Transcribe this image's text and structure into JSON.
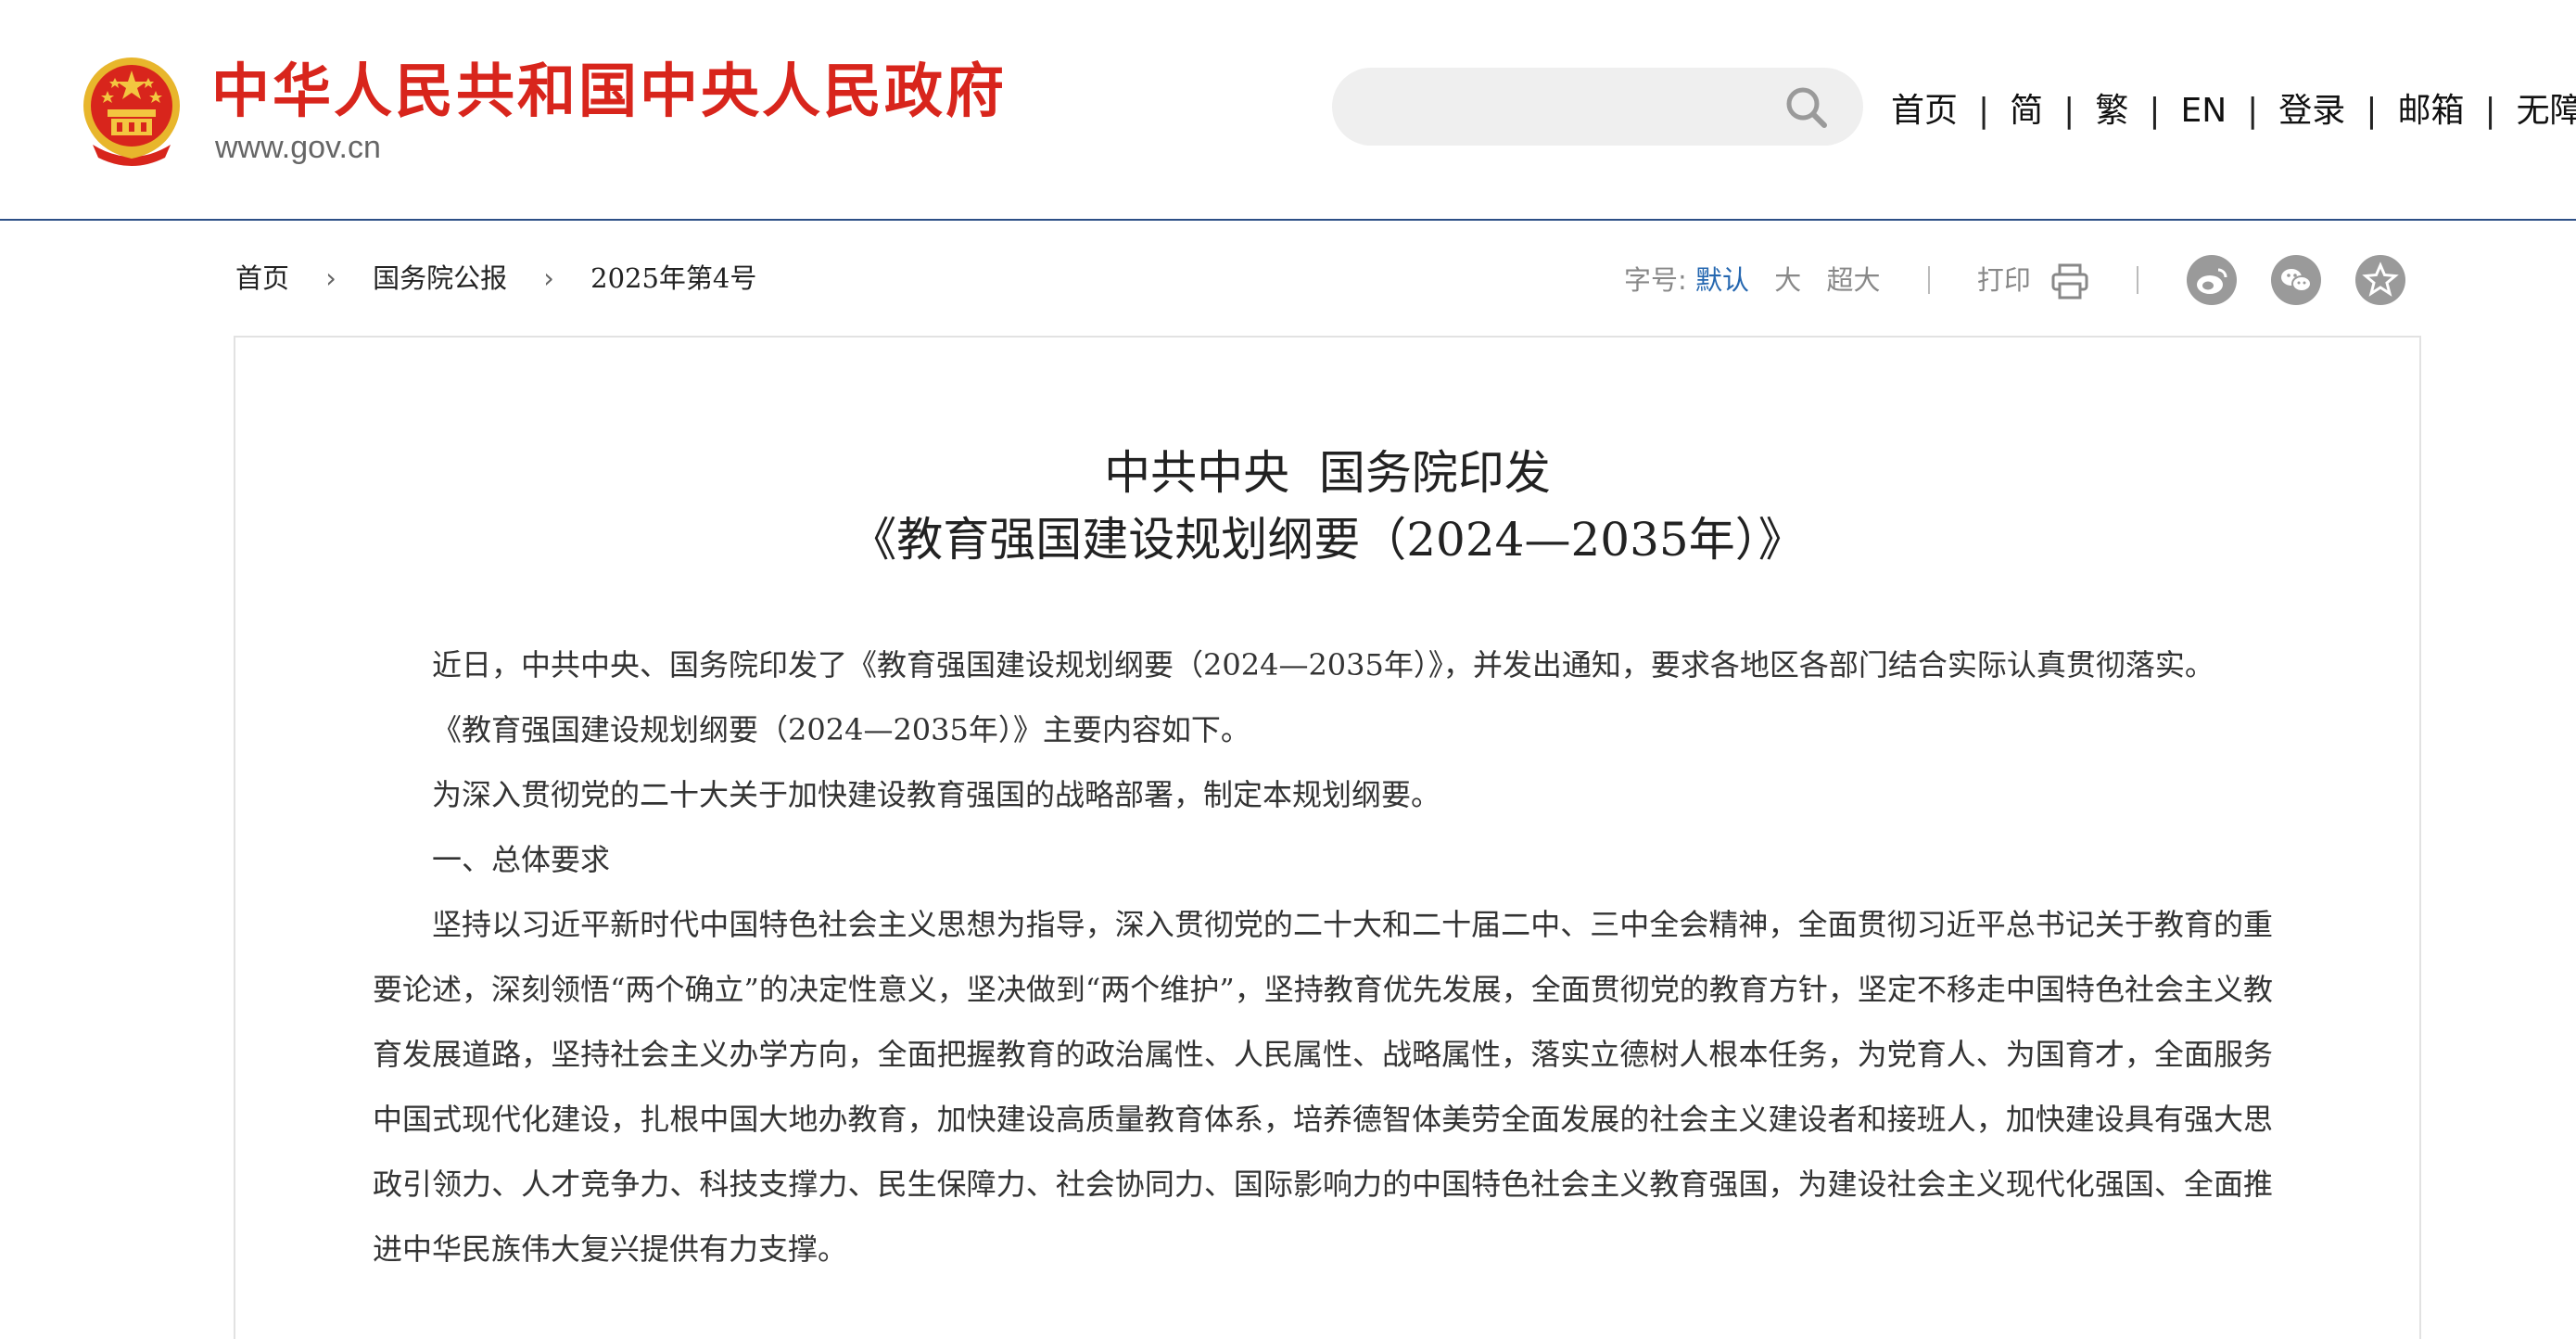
{
  "header": {
    "site_title": "中华人民共和国中央人民政府",
    "site_domain": "www.gov.cn",
    "search": {
      "placeholder": ""
    },
    "nav": [
      "首页",
      "简",
      "繁",
      "EN",
      "登录",
      "邮箱",
      "无障碍"
    ]
  },
  "breadcrumb": [
    "首页",
    "国务院公报",
    "2025年第4号"
  ],
  "tools": {
    "font_size_label": "字号:",
    "font_sizes": [
      "默认",
      "大",
      "超大"
    ],
    "print_label": "打印"
  },
  "article": {
    "title_line1": "中共中央  国务院印发",
    "title_line2": "《教育强国建设规划纲要（2024—2035年）》",
    "paragraphs": [
      "近日，中共中央、国务院印发了《教育强国建设规划纲要（2024—2035年）》，并发出通知，要求各地区各部门结合实际认真贯彻落实。",
      "《教育强国建设规划纲要（2024—2035年）》主要内容如下。",
      "为深入贯彻党的二十大关于加快建设教育强国的战略部署，制定本规划纲要。",
      "一、总体要求",
      "坚持以习近平新时代中国特色社会主义思想为指导，深入贯彻党的二十大和二十届二中、三中全会精神，全面贯彻习近平总书记关于教育的重要论述，深刻领悟“两个确立”的决定性意义，坚决做到“两个维护”，坚持教育优先发展，全面贯彻党的教育方针，坚定不移走中国特色社会主义教育发展道路，坚持社会主义办学方向，全面把握教育的政治属性、人民属性、战略属性，落实立德树人根本任务，为党育人、为国育才，全面服务中国式现代化建设，扎根中国大地办教育，加快建设高质量教育体系，培养德智体美劳全面发展的社会主义建设者和接班人，加快建设具有强大思政引领力、人才竞争力、科技支撑力、民生保障力、社会协同力、国际影响力的中国特色社会主义教育强国，为建设社会主义现代化强国、全面推进中华民族伟大复兴提供有力支撑。"
    ]
  },
  "colors": {
    "brand_red": "#d8251c",
    "header_rule": "#2c4f86",
    "active_link": "#2567b0"
  }
}
